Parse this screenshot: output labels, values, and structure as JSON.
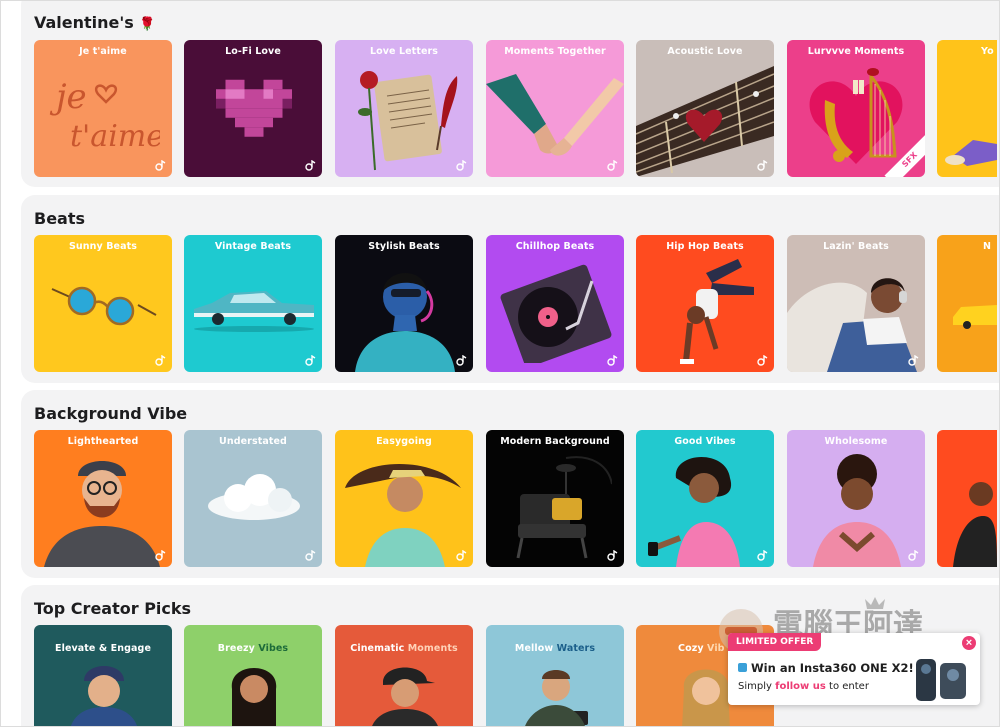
{
  "sections": [
    {
      "title": "Valentine's",
      "title_icon": "rose-icon",
      "cards": [
        {
          "title": "Je t'aime",
          "bg": "#f9955d",
          "art": "je-taime-lettering"
        },
        {
          "title": "Lo-Fi Love",
          "bg": "#4a0d38",
          "art": "pixel-heart"
        },
        {
          "title": "Love Letters",
          "bg": "#d7b0f2",
          "art": "letter-rose-quill"
        },
        {
          "title": "Moments Together",
          "bg": "#f59ad8",
          "art": "holding-hands"
        },
        {
          "title": "Acoustic Love",
          "bg": "#c9beb9",
          "art": "guitar-heart"
        },
        {
          "title": "Lurvvve Moments",
          "bg": "#ec3f8a",
          "art": "saxophone-harp",
          "badge": "SFX"
        },
        {
          "title": "Yo",
          "bg": "#ffc31a",
          "art": "partial"
        }
      ]
    },
    {
      "title": "Beats",
      "cards": [
        {
          "title": "Sunny Beats",
          "bg": "#ffc81e",
          "art": "sunglasses"
        },
        {
          "title": "Vintage Beats",
          "bg": "#1ecad0",
          "art": "vintage-car"
        },
        {
          "title": "Stylish Beats",
          "bg": "#0b0b12",
          "art": "neon-portrait"
        },
        {
          "title": "Chillhop Beats",
          "bg": "#b24bf0",
          "art": "turntable"
        },
        {
          "title": "Hip Hop Beats",
          "bg": "#ff4b1f",
          "art": "breakdancer"
        },
        {
          "title": "Lazin' Beats",
          "bg": "#cdbdb6",
          "art": "woman-headphones"
        },
        {
          "title": "N",
          "bg": "#f8a21a",
          "art": "partial"
        }
      ]
    },
    {
      "title": "Background Vibe",
      "cards": [
        {
          "title": "Lighthearted",
          "bg": "#ff7e1f",
          "art": "bearded-man"
        },
        {
          "title": "Understated",
          "bg": "#a9c4d0",
          "art": "cloud"
        },
        {
          "title": "Easygoing",
          "bg": "#ffc21a",
          "art": "woman-hair"
        },
        {
          "title": "Modern Background",
          "bg": "#040404",
          "art": "chair-lamp"
        },
        {
          "title": "Good Vibes",
          "bg": "#22c9cf",
          "art": "woman-phone"
        },
        {
          "title": "Wholesome",
          "bg": "#d5aef0",
          "art": "woman-smile"
        },
        {
          "title": "",
          "bg": "#ff4b1f",
          "art": "partial"
        }
      ]
    },
    {
      "title": "Top Creator Picks",
      "cards": [
        {
          "title": "Elevate & Engage",
          "bg": "#1f5a5d",
          "art": "man-beanie"
        },
        {
          "title": "Breezy Vibes",
          "title_accent": "Vibes",
          "bg": "#8ed06a",
          "art": "woman-dark-hair"
        },
        {
          "title": "Cinematic Moments",
          "title_accent": "Moments",
          "bg": "#e55a3a",
          "art": "man-cap"
        },
        {
          "title": "Mellow Waters",
          "title_accent": "Waters",
          "bg": "#8ec7d8",
          "art": "man-camera"
        },
        {
          "title": "Cozy Vib",
          "title_accent": "Vib",
          "bg": "#ef8a3c",
          "art": "woman-blonde"
        }
      ]
    }
  ],
  "ad": {
    "tag": "LIMITED OFFER",
    "headline": "Win an Insta360 ONE X2!",
    "sub_prefix": "Simply",
    "sub_link": "follow us",
    "sub_suffix": "to enter",
    "close": "×"
  },
  "watermark": {
    "brand": "電腦王阿達",
    "url": "http://www.kocpc.com.tw"
  }
}
